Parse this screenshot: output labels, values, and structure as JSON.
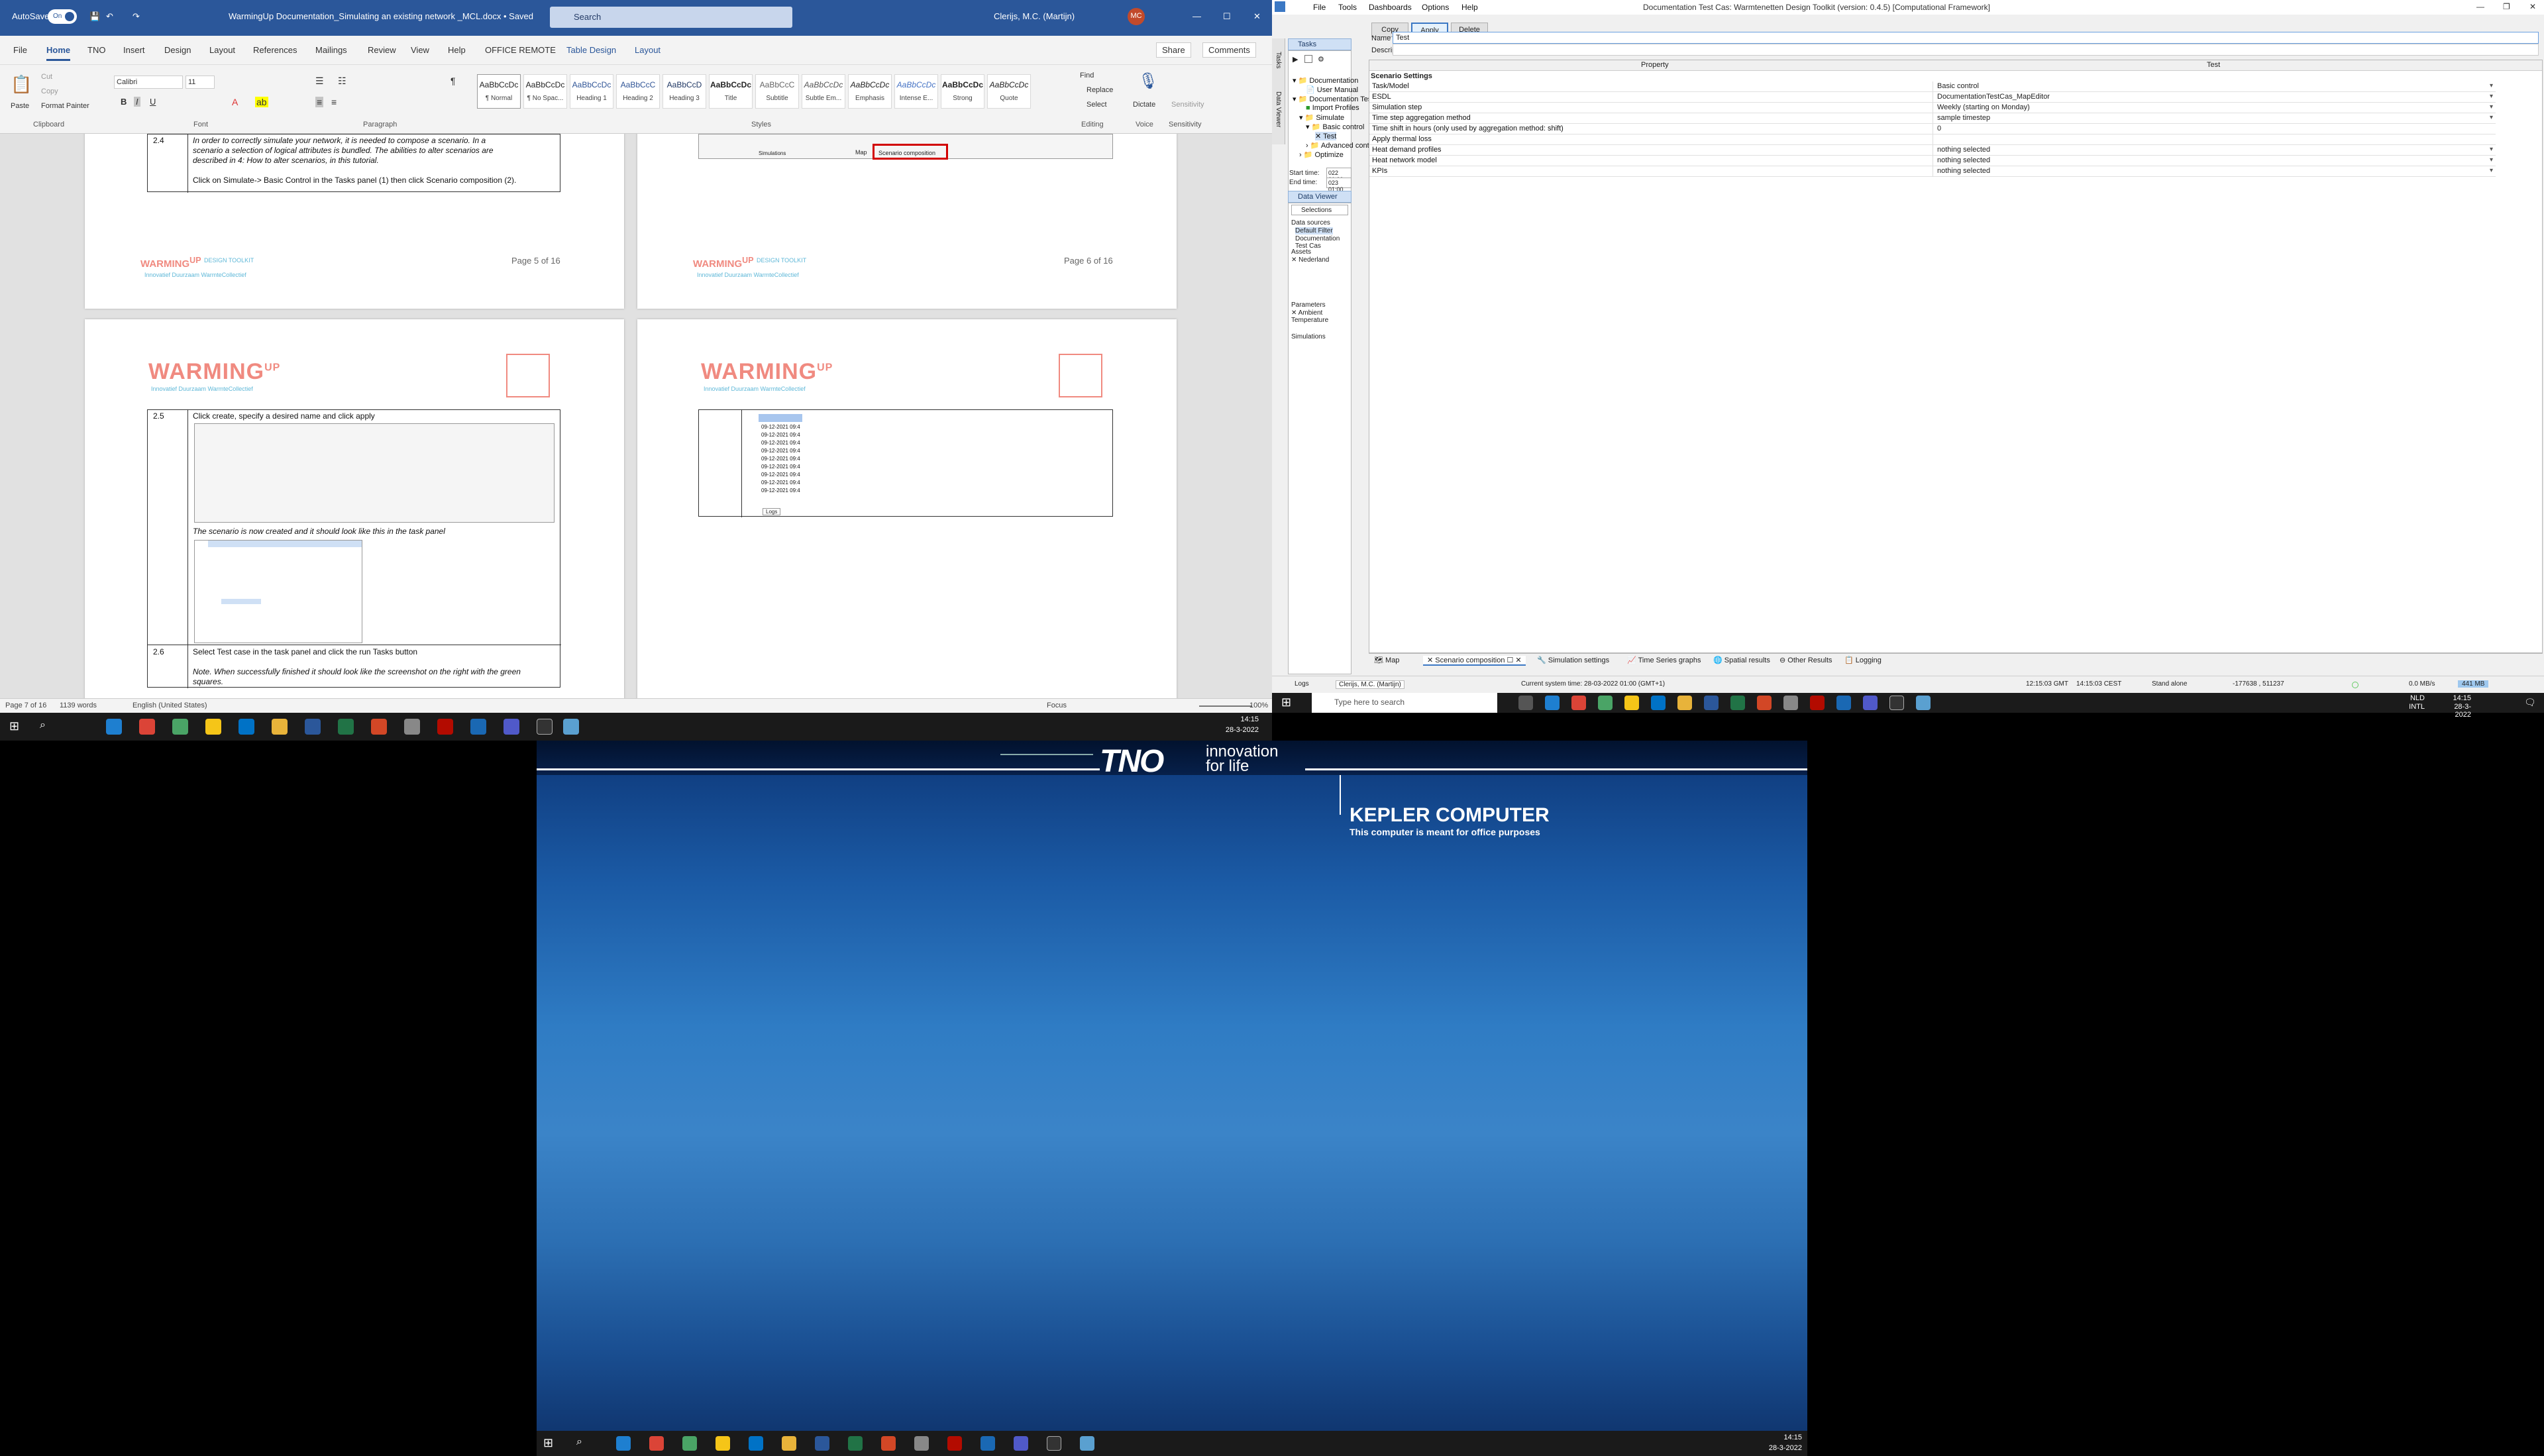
{
  "word": {
    "autosave_label": "AutoSave",
    "autosave_state": "On",
    "doc_title": "WarmingUp Documentation_Simulating an existing network _MCL.docx • Saved",
    "search_placeholder": "Search",
    "user_name": "Clerijs, M.C. (Martijn)",
    "user_initials": "MC",
    "tabs": [
      "File",
      "Home",
      "TNO",
      "Insert",
      "Design",
      "Layout",
      "References",
      "Mailings",
      "Review",
      "View",
      "Help",
      "OFFICE REMOTE",
      "Table Design",
      "Layout"
    ],
    "share_label": "Share",
    "comments_label": "Comments",
    "clipboard": {
      "paste": "Paste",
      "cut": "Cut",
      "copy": "Copy",
      "format_painter": "Format Painter",
      "group": "Clipboard"
    },
    "font": {
      "name": "Calibri",
      "size": "11",
      "group": "Font"
    },
    "paragraph_group": "Paragraph",
    "styles": [
      {
        "preview": "AaBbCcDc",
        "name": "¶ Normal"
      },
      {
        "preview": "AaBbCcDc",
        "name": "¶ No Spac..."
      },
      {
        "preview": "AaBbCcDc",
        "name": "Heading 1"
      },
      {
        "preview": "AaBbCcC",
        "name": "Heading 2"
      },
      {
        "preview": "AaBbCcD",
        "name": "Heading 3"
      },
      {
        "preview": "AaBbCcDc",
        "name": "Title"
      },
      {
        "preview": "AaBbCcC",
        "name": "Subtitle"
      },
      {
        "preview": "AaBbCcDc",
        "name": "Subtle Em..."
      },
      {
        "preview": "AaBbCcDc",
        "name": "Emphasis"
      },
      {
        "preview": "AaBbCcDc",
        "name": "Intense E..."
      },
      {
        "preview": "AaBbCcDc",
        "name": "Strong"
      },
      {
        "preview": "AaBbCcDc",
        "name": "Quote"
      }
    ],
    "styles_group": "Styles",
    "editing": {
      "find": "Find",
      "replace": "Replace",
      "select": "Select",
      "group": "Editing"
    },
    "voice": {
      "dictate": "Dictate",
      "group": "Voice"
    },
    "sensitivity": {
      "label": "Sensitivity",
      "group": "Sensitivity"
    },
    "page5": {
      "row_num": "2.4",
      "text_lines": [
        "In order to correctly simulate your network, it is needed to compose a scenario. In a",
        "scenario a selection of logical attributes is bundled. The abilities to alter scenarios are",
        "described in 4: How to alter scenarios, in this tutorial."
      ],
      "instruction": "Click on Simulate-> Basic Control in the Tasks panel (1) then click Scenario composition (2).",
      "page_label": "Page 5 of 16"
    },
    "page6": {
      "page_label": "Page 6 of 16",
      "shot_labels": [
        "Simulations",
        "Map",
        "Scenario composition"
      ]
    },
    "logo": {
      "brand": "WARMING",
      "up": "UP",
      "tagline": "Innovatief Duurzaam WarmteCollectief",
      "small_brand": "WARMING",
      "small_up": "UP",
      "small_extra": "DESIGN TOOLKIT"
    },
    "page7": {
      "row1_num": "2.5",
      "row1_text": "Click create, specify a desired name and click apply",
      "row1_note": "The scenario is now created and it should look like this in the task panel",
      "row2_num": "2.6",
      "row2_text": "Select Test case in the task panel and click the run Tasks button",
      "row2_note": "Note. When successfully finished it should look like the screenshot on the right with the green squares."
    },
    "page8": {
      "list_title": "",
      "list_items": [
        "09-12-2021 09:4",
        "09-12-2021 09:4",
        "09-12-2021 09:4",
        "09-12-2021 09:4",
        "09-12-2021 09:4",
        "09-12-2021 09:4",
        "09-12-2021 09:4",
        "09-12-2021 09:4",
        "09-12-2021 09:4"
      ],
      "logs_label": "Logs"
    },
    "status": {
      "page": "Page 7 of 16",
      "words": "1139 words",
      "language": "English (United States)",
      "focus": "Focus",
      "zoom": "100%"
    }
  },
  "taskbar_left": {
    "time": "14:15",
    "date": "28-3-2022"
  },
  "toolkit": {
    "title": "Documentation Test Cas: Warmtenetten Design Toolkit (version: 0.4.5) [Computational Framework]",
    "menu": [
      "File",
      "Tools",
      "Dashboards",
      "Options",
      "Help"
    ],
    "tasks_panel": "Tasks",
    "side_tabs": [
      "Tasks",
      "Data Viewer"
    ],
    "tree": [
      {
        "label": "Documentation",
        "level": 0
      },
      {
        "label": "User Manual",
        "level": 1
      },
      {
        "label": "Documentation Test Cas",
        "level": 0
      },
      {
        "label": "Import Profiles",
        "level": 1
      },
      {
        "label": "Simulate",
        "level": 1
      },
      {
        "label": "Basic control",
        "level": 2
      },
      {
        "label": "Test",
        "level": 3
      },
      {
        "label": "Advanced control",
        "level": 2
      },
      {
        "label": "Optimize",
        "level": 1
      }
    ],
    "start_time_label": "Start time:",
    "start_time": "022 01:00",
    "end_time_label": "End time:",
    "end_time": "023 01:00",
    "data_viewer_panel": "Data Viewer",
    "selections": "Selections",
    "data_sources_label": "Data sources",
    "data_sources": [
      "Default Filter",
      "Documentation Test Cas"
    ],
    "assets_label": "Assets",
    "assets": [
      "Nederland"
    ],
    "parameters_label": "Parameters",
    "parameters": [
      "Ambient Temperature"
    ],
    "simulations_label": "Simulations",
    "buttons": {
      "copy": "Copy",
      "apply": "Apply",
      "delete": "Delete"
    },
    "name_label": "Name",
    "name_value": "Test",
    "description_label": "Description",
    "grid_headers": [
      "Property",
      "Test"
    ],
    "grid_section": "Scenario Settings",
    "grid_rows": [
      {
        "k": "Task/Model",
        "v": "Basic control",
        "dd": true
      },
      {
        "k": "ESDL",
        "v": "DocumentationTestCas_MapEditor",
        "dd": true
      },
      {
        "k": "Simulation step",
        "v": "Weekly (starting on Monday)",
        "dd": true
      },
      {
        "k": "Time step aggregation method",
        "v": "sample timestep",
        "dd": true
      },
      {
        "k": "Time shift in hours (only used by aggregation method: shift)",
        "v": "0",
        "dd": false
      },
      {
        "k": "Apply thermal loss",
        "v": "",
        "dd": false
      },
      {
        "k": "Heat demand profiles",
        "v": "nothing selected",
        "dd": true
      },
      {
        "k": "Heat network model",
        "v": "nothing selected",
        "dd": true
      },
      {
        "k": "KPIs",
        "v": "nothing selected",
        "dd": true
      }
    ],
    "bottom_tabs": [
      "Map",
      "Scenario composition",
      "Simulation settings",
      "Time Series graphs",
      "Spatial results",
      "Other Results",
      "Logging"
    ],
    "logs_label": "Logs",
    "status": {
      "user": "Clerijs, M.C. (Martijn)",
      "system_time": "Current system time: 28-03-2022 01:00 (GMT+1)",
      "gmt": "12:15:03 GMT",
      "cest": "14:15:03 CEST",
      "mode": "Stand alone",
      "coords": "-177638 , 511237",
      "rate": "0.0 MB/s",
      "memory": "441 MB"
    }
  },
  "taskbar_right": {
    "search_placeholder": "Type here to search",
    "lang": "NLD",
    "layout": "INTL",
    "time": "14:15",
    "date": "28-3-2022"
  },
  "kepler": {
    "brand": "TNO",
    "tagline_1": "innovation",
    "tagline_2": "for life",
    "computer_name": "KEPLER COMPUTER",
    "subtitle": "This computer is meant for office purposes",
    "time": "14:15",
    "date": "28-3-2022"
  },
  "colors": {
    "word_blue": "#2b579a",
    "tno_blue": "#0d3778",
    "accent_select": "#cfe0f5"
  }
}
